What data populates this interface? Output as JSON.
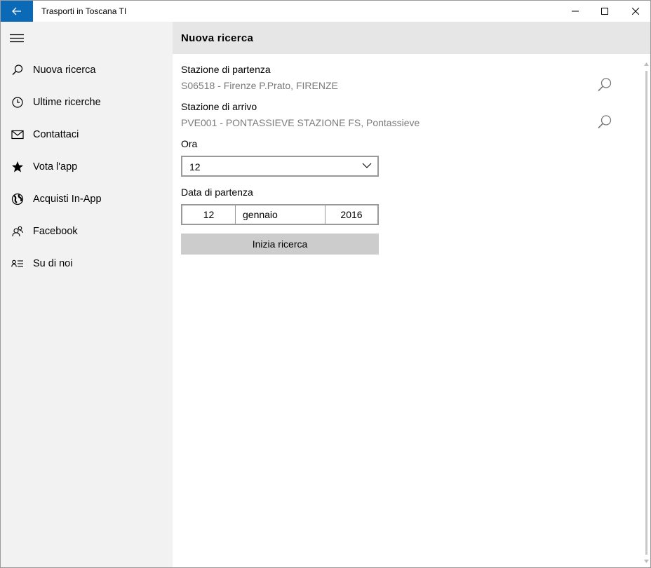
{
  "window": {
    "title": "Trasporti in Toscana TI",
    "accent_color": "#0b6ab7"
  },
  "sidebar": {
    "items": [
      {
        "label": "Nuova ricerca",
        "icon": "search-icon"
      },
      {
        "label": "Ultime ricerche",
        "icon": "clock-icon"
      },
      {
        "label": "Contattaci",
        "icon": "mail-icon"
      },
      {
        "label": "Vota l'app",
        "icon": "star-icon"
      },
      {
        "label": "Acquisti In-App",
        "icon": "globe-icon"
      },
      {
        "label": "Facebook",
        "icon": "people-icon"
      },
      {
        "label": "Su di noi",
        "icon": "contact-info-icon"
      }
    ]
  },
  "header": {
    "title": "Nuova ricerca"
  },
  "form": {
    "departure_label": "Stazione di partenza",
    "departure_value": "S06518 - Firenze P.Prato, FIRENZE",
    "arrival_label": "Stazione di arrivo",
    "arrival_value": "PVE001 - PONTASSIEVE STAZIONE FS, Pontassieve",
    "hour_label": "Ora",
    "hour_value": "12",
    "date_label": "Data di partenza",
    "date_day": "12",
    "date_month": "gennaio",
    "date_year": "2016",
    "submit_label": "Inizia ricerca"
  }
}
